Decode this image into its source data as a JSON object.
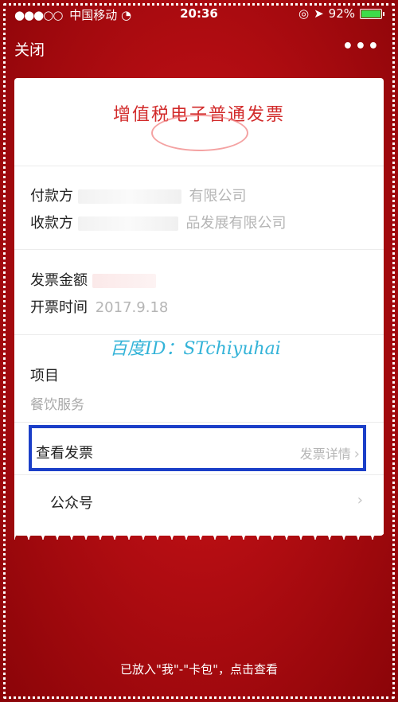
{
  "status_bar": {
    "signal": "●●●○○",
    "carrier": "中国移动",
    "wifi_icon": "wifi-icon",
    "time": "20:36",
    "battery_percent": "92%",
    "battery_level": 0.92
  },
  "nav": {
    "close_label": "关闭",
    "more_label": "•••"
  },
  "invoice": {
    "title": "增值税电子普通发票",
    "payer_label": "付款方",
    "payer_value": "有限公司",
    "payee_label": "收款方",
    "payee_value": "品发展有限公司",
    "amount_label": "发票金额",
    "issue_time_label": "开票时间",
    "issue_time_value": "2017.9.18",
    "items_label": "项目",
    "items_value": "餐饮服务",
    "view_invoice_label": "查看发票",
    "invoice_detail_label": "发票详情",
    "official_account_label": "公众号"
  },
  "watermark": "百度ID：STchiyuhai",
  "footer_text": "已放入\"我\"-\"卡包\"，点击查看"
}
